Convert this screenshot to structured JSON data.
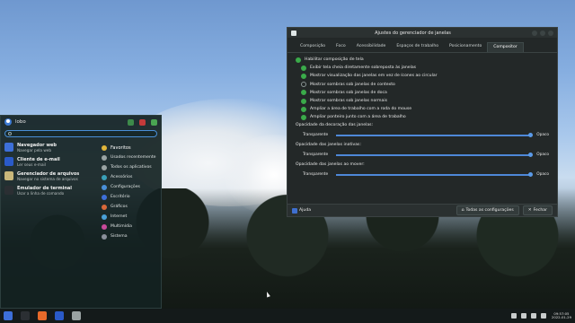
{
  "menu": {
    "user_name": "lobo",
    "favorites": [
      {
        "title": "Navegador web",
        "desc": "Navegar pela web",
        "color": "#3d6fd8"
      },
      {
        "title": "Cliente de e-mail",
        "desc": "Ler seus e-mail",
        "color": "#2a5ac8"
      },
      {
        "title": "Gerenciador de arquivos",
        "desc": "Navegar no sistema de arquivos",
        "color": "#c9b77a"
      },
      {
        "title": "Emulador de terminal",
        "desc": "Usar a linha de comando",
        "color": "#2b2f33"
      }
    ],
    "categories": [
      {
        "label": "Favoritos",
        "color": "#e0b53a"
      },
      {
        "label": "Usados recentemente",
        "color": "#9aa3a3"
      },
      {
        "label": "Todos os aplicativos",
        "color": "#9aa3a3"
      },
      {
        "label": "Acessórios",
        "color": "#3aa0b8"
      },
      {
        "label": "Configurações",
        "color": "#4a8fd8"
      },
      {
        "label": "Escritório",
        "color": "#3d6fd8"
      },
      {
        "label": "Gráficos",
        "color": "#d8683a"
      },
      {
        "label": "Internet",
        "color": "#4aa0d8"
      },
      {
        "label": "Multimídia",
        "color": "#c84a9a"
      },
      {
        "label": "Sistema",
        "color": "#8a8f9a"
      }
    ]
  },
  "window": {
    "title": "Ajustes do gerenciador de janelas",
    "tabs": [
      "Composição",
      "Foco",
      "Acessibilidade",
      "Espaços de trabalho",
      "Posicionamento",
      "Compositor"
    ],
    "enable_label": "Habilitar composição de tela",
    "options": [
      {
        "label": "Exibir tela cheia diretamente sobreposta às janelas",
        "checked": true
      },
      {
        "label": "Mostrar visualização das janelas em vez de ícones ao circular",
        "checked": true
      },
      {
        "label": "Mostrar sombras sob janelas de contexto",
        "checked": false
      },
      {
        "label": "Mostrar sombras sob janelas de doca",
        "checked": true
      },
      {
        "label": "Mostrar sombras sob janelas normais",
        "checked": true
      },
      {
        "label": "Ampliar a área de trabalho com a roda do mouse",
        "checked": true
      },
      {
        "label": "Ampliar ponteiro junto com a área de trabalho",
        "checked": true
      }
    ],
    "sliders": [
      {
        "label": "Opacidade da decoração das janelas:",
        "min": "Transparente",
        "max": "Opaco",
        "value": 1.0
      },
      {
        "label": "Opacidade das janelas inativas:",
        "min": "Transparente",
        "max": "Opaco",
        "value": 1.0
      },
      {
        "label": "Opacidade das janelas ao mover:",
        "min": "Transparente",
        "max": "Opaco",
        "value": 1.0
      }
    ],
    "help_label": "Ajuda",
    "all_settings_label": "Todas as configurações",
    "close_label": "Fechar"
  },
  "taskbar": {
    "time": "09:57:05",
    "date": "2022-01-29",
    "apps": [
      {
        "name": "whisker-menu-icon",
        "color": "#3d6fd8"
      },
      {
        "name": "terminal-icon",
        "color": "#2b2f33"
      },
      {
        "name": "firefox-icon",
        "color": "#e86a2a"
      },
      {
        "name": "thunderbird-icon",
        "color": "#2a5ac8"
      },
      {
        "name": "settings-icon",
        "color": "#9aa3a3"
      }
    ]
  }
}
